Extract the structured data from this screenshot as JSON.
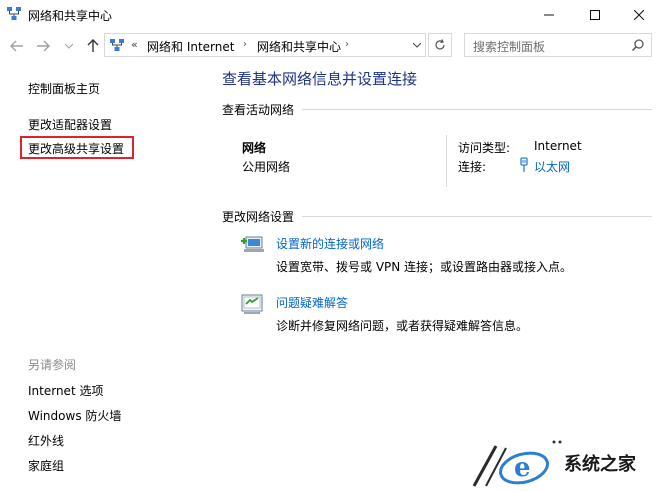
{
  "window": {
    "title": "网络和共享中心"
  },
  "nav": {
    "breadcrumb_sep": "«",
    "crumbs": [
      "网络和 Internet",
      "网络和共享中心"
    ],
    "search_placeholder": "搜索控制面板"
  },
  "sidebar": {
    "links": [
      "控制面板主页",
      "更改适配器设置",
      "更改高级共享设置"
    ],
    "see_also_label": "另请参阅",
    "see_also": [
      "Internet 选项",
      "Windows 防火墙",
      "红外线",
      "家庭组"
    ]
  },
  "main": {
    "title": "查看基本网络信息并设置连接",
    "active_section": "查看活动网络",
    "network": {
      "name": "网络",
      "type": "公用网络",
      "access_label": "访问类型:",
      "access_value": "Internet",
      "conn_label": "连接:",
      "conn_value": "以太网"
    },
    "change_section": "更改网络设置",
    "tasks": [
      {
        "link": "设置新的连接或网络",
        "desc": "设置宽带、拨号或 VPN 连接；或设置路由器或接入点。"
      },
      {
        "link": "问题疑难解答",
        "desc": "诊断并修复网络问题，或者获得疑难解答信息。"
      }
    ]
  },
  "watermark": {
    "text": "系统之家"
  },
  "colors": {
    "title_blue": "#1e3287",
    "link_blue": "#0066cc",
    "highlight_red": "#d9262c"
  }
}
